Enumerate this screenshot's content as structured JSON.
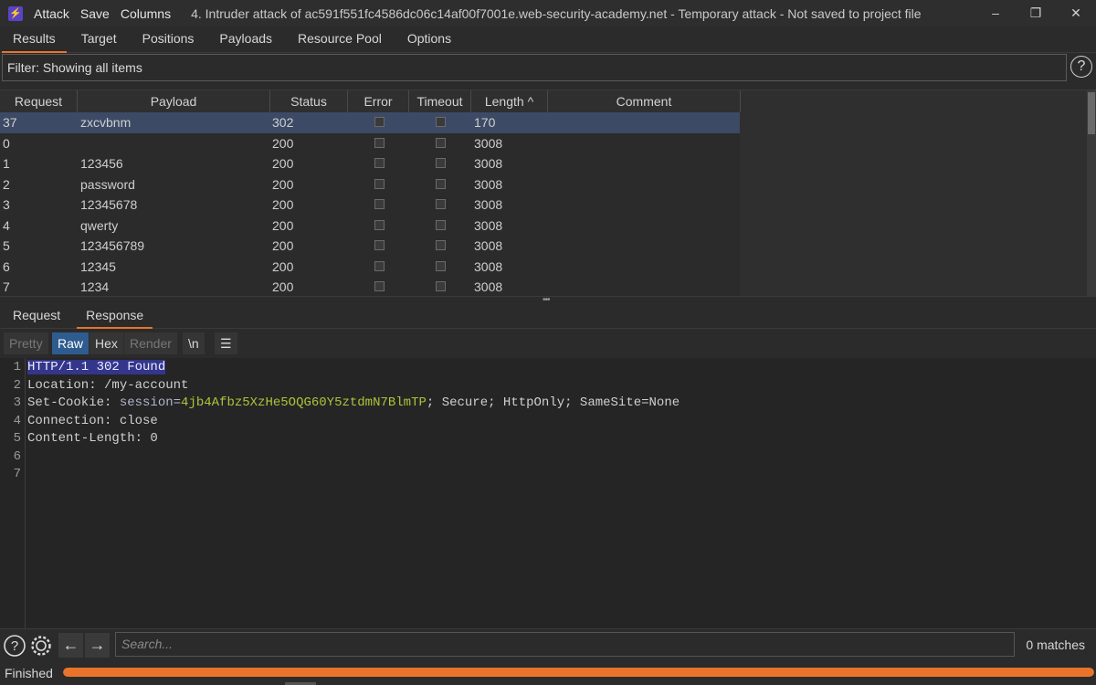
{
  "window": {
    "menu": [
      "Attack",
      "Save",
      "Columns"
    ],
    "title": "4. Intruder attack of ac591f551fc4586dc06c14af00f7001e.web-security-academy.net - Temporary attack - Not saved to project file"
  },
  "tabs": [
    "Results",
    "Target",
    "Positions",
    "Payloads",
    "Resource Pool",
    "Options"
  ],
  "filter": {
    "label": "Filter: Showing all items"
  },
  "table": {
    "columns": [
      "Request",
      "Payload",
      "Status",
      "Error",
      "Timeout",
      "Length",
      "Comment"
    ],
    "sort_indicator": "^",
    "rows": [
      {
        "request": "37",
        "payload": "zxcvbnm",
        "status": "302",
        "length": "170"
      },
      {
        "request": "0",
        "payload": "",
        "status": "200",
        "length": "3008"
      },
      {
        "request": "1",
        "payload": "123456",
        "status": "200",
        "length": "3008"
      },
      {
        "request": "2",
        "payload": "password",
        "status": "200",
        "length": "3008"
      },
      {
        "request": "3",
        "payload": "12345678",
        "status": "200",
        "length": "3008"
      },
      {
        "request": "4",
        "payload": "qwerty",
        "status": "200",
        "length": "3008"
      },
      {
        "request": "5",
        "payload": "123456789",
        "status": "200",
        "length": "3008"
      },
      {
        "request": "6",
        "payload": "12345",
        "status": "200",
        "length": "3008"
      },
      {
        "request": "7",
        "payload": "1234",
        "status": "200",
        "length": "3008"
      }
    ]
  },
  "subtabs": [
    "Request",
    "Response"
  ],
  "view_buttons": [
    "Pretty",
    "Raw",
    "Hex",
    "Render",
    "\\n"
  ],
  "response": {
    "line_numbers": [
      "1",
      "2",
      "3",
      "4",
      "5",
      "6",
      "7"
    ],
    "line1": "HTTP/1.1 302 Found",
    "line2": "Location: /my-account",
    "line3_key": "Set-Cookie: ",
    "line3_name": "session=",
    "line3_value": "4jb4Afbz5XzHe5OQG60Y5ztdmN7BlmTP",
    "line3_rest": "; Secure; HttpOnly; SameSite=None",
    "line4": "Connection: close",
    "line5": "Content-Length: 0"
  },
  "search": {
    "placeholder": "Search...",
    "matches": "0 matches"
  },
  "status": {
    "text": "Finished",
    "progress": 1.0
  },
  "colors": {
    "accent": "#e8742b",
    "selection": "#3c4a66",
    "raw_active": "#2e5c8f"
  }
}
